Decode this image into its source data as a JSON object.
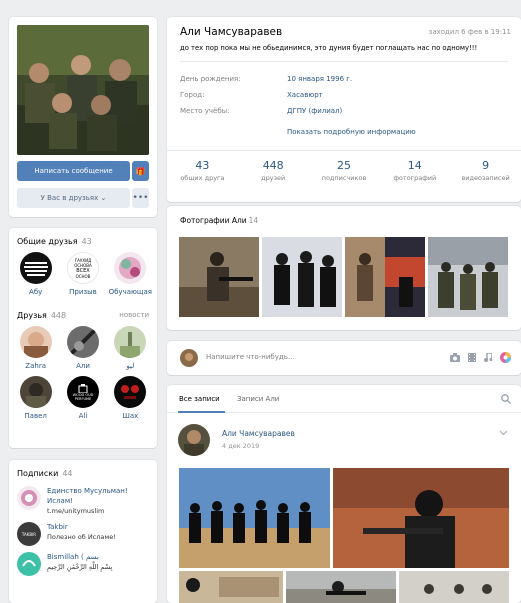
{
  "profile": {
    "message_button": "Написать сообщение",
    "friends_status_button": "У Вас в друзьях ⌄",
    "more_button": "•••"
  },
  "mutual_friends": {
    "title": "Общие друзья",
    "count": "43",
    "items": [
      {
        "name": "Абу"
      },
      {
        "name": "Призыв"
      },
      {
        "name": "Обучающая"
      }
    ]
  },
  "friends": {
    "title": "Друзья",
    "count": "448",
    "more": "новости",
    "items": [
      {
        "name": "Zahra"
      },
      {
        "name": "Али"
      },
      {
        "name": "ليو"
      },
      {
        "name": "Павел"
      },
      {
        "name": "Ali"
      },
      {
        "name": "Шах"
      }
    ]
  },
  "subscriptions": {
    "title": "Подписки",
    "count": "44",
    "items": [
      {
        "title": "Единство Мусульман! Ислам!",
        "sub": "t.me/unitymuslim",
        "avatar_text": ""
      },
      {
        "title": "Takbir",
        "sub": "Полезно об Исламе!",
        "avatar_text": "TAKBIR"
      },
      {
        "title": "Bismillah ( بسم",
        "sub": "بِسْمِ اللَّهِ الرَّحْمَٰنِ الرَّحِيمِ",
        "avatar_text": ""
      }
    ]
  },
  "info": {
    "name": "Али Чамсуваравев",
    "last_seen": "заходил 6 фев в 19:11",
    "status": "до тех пор пока мы не обьединимся, это дуния будет поглащать нас по одному!!!",
    "rows": [
      {
        "label": "День рождения:",
        "value": "10 января 1996 г."
      },
      {
        "label": "Город:",
        "value": "Хасавюрт"
      },
      {
        "label": "Место учёбы:",
        "value": "ДГПУ (филиал)"
      }
    ],
    "show_more": "Показать подробную информацию",
    "counters": [
      {
        "num": "43",
        "label": "общих друга"
      },
      {
        "num": "448",
        "label": "друзей"
      },
      {
        "num": "25",
        "label": "подписчиков"
      },
      {
        "num": "14",
        "label": "фотографий"
      },
      {
        "num": "9",
        "label": "видеозаписей"
      }
    ]
  },
  "photos": {
    "title": "Фотографии Али",
    "count": "14"
  },
  "compose": {
    "placeholder": "Напишите что-нибудь..."
  },
  "feed": {
    "tabs": [
      "Все записи",
      "Записи Али"
    ],
    "post": {
      "author": "Али Чамсуваравев",
      "date": "4 дек 2019"
    }
  },
  "mutual_avatar_texts": {
    "second_lines": [
      "ГАУХИД",
      "ОСНОВА",
      "ВСЕХ",
      "ОСНОВ"
    ]
  },
  "friend_avatar_ali": {
    "lines": [
      "WOOD OUD",
      "PERFUME"
    ]
  }
}
